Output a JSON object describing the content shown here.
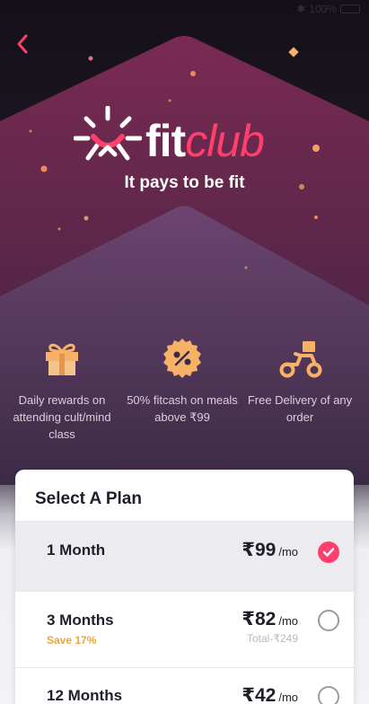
{
  "status_bar": {
    "battery": "100%"
  },
  "brand": {
    "fit": "fit",
    "club": "club",
    "tagline": "It pays to be fit"
  },
  "features": [
    {
      "icon": "gift-icon",
      "text": "Daily rewards on attending cult/mind class"
    },
    {
      "icon": "fitcash-coin-icon",
      "text": "50% fitcash on meals above ₹99"
    },
    {
      "icon": "scooter-icon",
      "text": "Free Delivery of any order"
    }
  ],
  "plans": {
    "title": "Select A Plan",
    "items": [
      {
        "name": "1 Month",
        "price": "₹99",
        "unit": "/mo",
        "save": "",
        "total": "",
        "selected": true
      },
      {
        "name": "3 Months",
        "price": "₹82",
        "unit": "/mo",
        "save": "Save 17%",
        "total": "Total-₹249",
        "selected": false
      },
      {
        "name": "12 Months",
        "price": "₹42",
        "unit": "/mo",
        "save": "",
        "total": "",
        "selected": false
      }
    ]
  },
  "colors": {
    "accent": "#ff3f6c",
    "save": "#f0a23a",
    "icon_orange": "#f7b267"
  }
}
